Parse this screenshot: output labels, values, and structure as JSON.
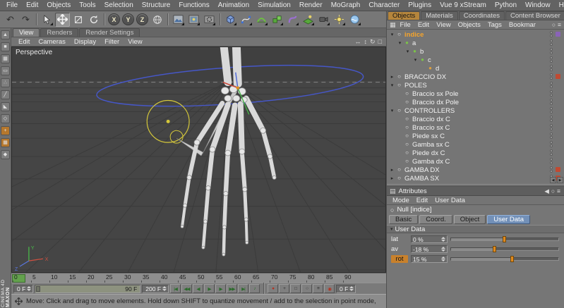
{
  "app": {
    "branding_line1": "MAXON",
    "branding_line2": "CINEMA 4D"
  },
  "icons": {
    "pan": "↔",
    "zoom": "↕",
    "rotate_view": "↻",
    "toggle_view": "□",
    "search": "○",
    "menu": "≡",
    "grid": "▦",
    "sliders": "▤",
    "scroll_left": "◀",
    "scroll_right": "▶",
    "null_obj": "○",
    "section_open": "▾",
    "undo": "↶",
    "redo": "↷"
  },
  "menubar": {
    "items": [
      "File",
      "Edit",
      "Objects",
      "Tools",
      "Selection",
      "Structure",
      "Functions",
      "Animation",
      "Simulation",
      "Render",
      "MoGraph",
      "Character",
      "Plugins",
      "Vue 9 xStream",
      "Python",
      "Window",
      "Help"
    ]
  },
  "toolbar": {
    "axis_x": "X",
    "axis_y": "Y",
    "axis_z": "Z"
  },
  "left_rail": {
    "icons": [
      {
        "name": "make-editable-icon",
        "glyph": "▲"
      },
      {
        "name": "model-mode-icon",
        "glyph": "■"
      },
      {
        "name": "texture-mode-icon",
        "glyph": "▦"
      },
      {
        "name": "workplane-mode-icon",
        "glyph": "▭"
      },
      {
        "name": "points-mode-icon",
        "glyph": "∴"
      },
      {
        "name": "edges-mode-icon",
        "glyph": "╱"
      },
      {
        "name": "polygons-mode-icon",
        "glyph": "◣"
      },
      {
        "name": "animation-mode-icon",
        "glyph": "◇"
      },
      {
        "name": "enable-axis-icon",
        "glyph": "+",
        "orange": true
      },
      {
        "name": "texture-axis-icon",
        "glyph": "▦",
        "orange": true
      },
      {
        "name": "snap-icon",
        "glyph": "◆"
      }
    ]
  },
  "viewport": {
    "tabs": [
      {
        "label": "View",
        "active": true
      },
      {
        "label": "Renders"
      },
      {
        "label": "Render Settings"
      }
    ],
    "menu_items": [
      "Edit",
      "Cameras",
      "Display",
      "Filter",
      "View"
    ],
    "view_label": "Perspective",
    "gizmo": {
      "x": "X",
      "y": "Y",
      "z": "Z"
    }
  },
  "timeline": {
    "ticks": [
      "0",
      "5",
      "10",
      "15",
      "20",
      "25",
      "30",
      "35",
      "40",
      "45",
      "50",
      "55",
      "60",
      "65",
      "70",
      "75",
      "80",
      "85",
      "90"
    ],
    "current_frame": "0 F",
    "range_end": "90 F",
    "project_end": "200 F",
    "aux_frame": "0 F",
    "transport_buttons": [
      {
        "name": "goto-start-button",
        "glyph": "|◀"
      },
      {
        "name": "prev-key-button",
        "glyph": "◀◀"
      },
      {
        "name": "prev-frame-button",
        "glyph": "◀"
      },
      {
        "name": "play-button",
        "glyph": "▶"
      },
      {
        "name": "next-frame-button",
        "glyph": "▶"
      },
      {
        "name": "next-key-button",
        "glyph": "▶▶"
      },
      {
        "name": "goto-end-button",
        "glyph": "▶|"
      },
      {
        "name": "play-sound-button",
        "glyph": "♪"
      }
    ],
    "record_buttons": [
      {
        "name": "record-keyframe-button",
        "glyph": "●",
        "color": "#b53120"
      },
      {
        "name": "record-position-toggle",
        "glyph": "+",
        "color": "#2e2e2e"
      },
      {
        "name": "record-scale-toggle",
        "glyph": "□",
        "color": "#2e2e2e"
      },
      {
        "name": "record-rotation-toggle",
        "glyph": "○",
        "color": "#2e2e2e"
      },
      {
        "name": "record-parameter-toggle",
        "glyph": "≡",
        "color": "#2e2e2e"
      },
      {
        "name": "autokey-button",
        "glyph": "◉",
        "color": "#b53120"
      }
    ]
  },
  "statusbar": {
    "text": "Move: Click and drag to move elements. Hold down SHIFT to quantize movement / add to the selection in point mode,"
  },
  "right_panel": {
    "tabs": [
      {
        "label": "Objects",
        "active": true
      },
      {
        "label": "Materials"
      },
      {
        "label": "Coordinates"
      },
      {
        "label": "Content Browser"
      }
    ],
    "object_manager": {
      "menu_items": [
        "File",
        "Edit",
        "View",
        "Objects",
        "Tags",
        "Bookmar"
      ],
      "tree": [
        {
          "label": "indice",
          "level": 0,
          "exp": "▾",
          "icon": "○",
          "icon_color": "#ececec",
          "selected": true,
          "badge": "#8a63b8"
        },
        {
          "label": "a",
          "level": 1,
          "exp": "▾",
          "icon": "●",
          "icon_color": "#7cc24a"
        },
        {
          "label": "b",
          "level": 2,
          "exp": "▾",
          "icon": "●",
          "icon_color": "#7cc24a"
        },
        {
          "label": "c",
          "level": 3,
          "exp": "▾",
          "icon": "●",
          "icon_color": "#7cc24a"
        },
        {
          "label": "d",
          "level": 4,
          "exp": "",
          "icon": "●",
          "icon_color": "#e0a03c"
        },
        {
          "label": "BRACCIO DX",
          "level": 0,
          "exp": "▸",
          "icon": "○",
          "icon_color": "#ececec",
          "badge": "#c04a32"
        },
        {
          "label": "POLES",
          "level": 0,
          "exp": "▾",
          "icon": "○",
          "icon_color": "#ececec"
        },
        {
          "label": "Braccio sx Pole",
          "level": 1,
          "exp": "",
          "icon": "○",
          "icon_color": "#ececec"
        },
        {
          "label": "Braccio dx Pole",
          "level": 1,
          "exp": "",
          "icon": "○",
          "icon_color": "#ececec"
        },
        {
          "label": "CONTROLLERS",
          "level": 0,
          "exp": "▾",
          "icon": "○",
          "icon_color": "#ececec"
        },
        {
          "label": "Braccio dx C",
          "level": 1,
          "exp": "",
          "icon": "○",
          "icon_color": "#ececec"
        },
        {
          "label": "Braccio sx C",
          "level": 1,
          "exp": "",
          "icon": "○",
          "icon_color": "#ececec"
        },
        {
          "label": "Piede sx C",
          "level": 1,
          "exp": "",
          "icon": "○",
          "icon_color": "#ececec"
        },
        {
          "label": "Gamba sx C",
          "level": 1,
          "exp": "",
          "icon": "○",
          "icon_color": "#ececec"
        },
        {
          "label": "Piede dx C",
          "level": 1,
          "exp": "",
          "icon": "○",
          "icon_color": "#ececec"
        },
        {
          "label": "Gamba dx C",
          "level": 1,
          "exp": "",
          "icon": "○",
          "icon_color": "#ececec"
        },
        {
          "label": "GAMBA DX",
          "level": 0,
          "exp": "▸",
          "icon": "○",
          "icon_color": "#ececec",
          "badge": "#c04a32"
        },
        {
          "label": "GAMBA SX",
          "level": 0,
          "exp": "▸",
          "icon": "○",
          "icon_color": "#ececec",
          "badge": "#c04a32"
        }
      ]
    },
    "attributes": {
      "title": "Attributes",
      "menu_items": [
        "Mode",
        "Edit",
        "User Data"
      ],
      "object_name": "Null [indice]",
      "tabs": [
        {
          "label": "Basic"
        },
        {
          "label": "Coord."
        },
        {
          "label": "Object"
        },
        {
          "label": "User Data",
          "active": true
        }
      ],
      "section_title": "User Data",
      "params": [
        {
          "name": "lat",
          "value": "0 %",
          "pct": "50%"
        },
        {
          "name": "av",
          "value": "-18 %",
          "pct": "41%"
        },
        {
          "name": "rot",
          "value": "15 %",
          "pct": "57%",
          "selected": true
        }
      ]
    }
  }
}
